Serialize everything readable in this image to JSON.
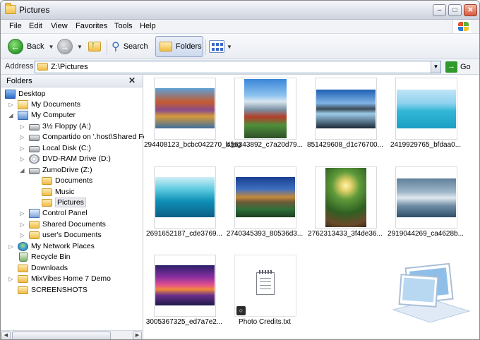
{
  "window": {
    "title": "Pictures",
    "controls": {
      "minimize": "–",
      "maximize": "□",
      "close": "✕"
    }
  },
  "menu": [
    "File",
    "Edit",
    "View",
    "Favorites",
    "Tools",
    "Help"
  ],
  "toolbar": {
    "back_label": "Back",
    "search_label": "Search",
    "folders_label": "Folders"
  },
  "address": {
    "label": "Address",
    "path": "Z:\\Pictures",
    "go_label": "Go"
  },
  "folders_pane": {
    "title": "Folders",
    "close": "✕",
    "tree": [
      {
        "label": "Desktop",
        "icon": "desktop-icon"
      },
      {
        "label": "My Documents",
        "icon": "my-documents-icon"
      },
      {
        "label": "My Computer",
        "icon": "my-computer-icon"
      },
      {
        "label": "3½ Floppy (A:)",
        "icon": "floppy-drive-icon"
      },
      {
        "label": "Compartido on '.host\\Shared Fol",
        "icon": "network-drive-icon"
      },
      {
        "label": "Local Disk (C:)",
        "icon": "local-disk-icon"
      },
      {
        "label": "DVD-RAM Drive (D:)",
        "icon": "dvd-drive-icon"
      },
      {
        "label": "ZumoDrive (Z:)",
        "icon": "zumodrive-icon"
      },
      {
        "label": "Documents",
        "icon": "folder-icon"
      },
      {
        "label": "Music",
        "icon": "folder-icon"
      },
      {
        "label": "Pictures",
        "icon": "folder-icon",
        "selected": true
      },
      {
        "label": "Control Panel",
        "icon": "control-panel-icon"
      },
      {
        "label": "Shared Documents",
        "icon": "folder-icon"
      },
      {
        "label": "user's Documents",
        "icon": "folder-icon"
      },
      {
        "label": "My Network Places",
        "icon": "network-places-icon"
      },
      {
        "label": "Recycle Bin",
        "icon": "recycle-bin-icon"
      },
      {
        "label": "Downloads",
        "icon": "folder-icon"
      },
      {
        "label": "MixVibes Home 7 Demo",
        "icon": "folder-icon"
      },
      {
        "label": "SCREENSHOTS",
        "icon": "folder-icon"
      }
    ]
  },
  "files": [
    {
      "caption": "294408123_bcbc042270_b.jpg",
      "icon": "image-thumbnail",
      "theme": "colorful-town"
    },
    {
      "caption": "456343892_c7a20d79...",
      "icon": "image-thumbnail",
      "theme": "city-skyline"
    },
    {
      "caption": "851429608_d1c76700...",
      "icon": "image-thumbnail",
      "theme": "mountain-lake"
    },
    {
      "caption": "2419929765_bfdaa0...",
      "icon": "image-thumbnail",
      "theme": "tropical-sea"
    },
    {
      "caption": "2691652187_cde3769...",
      "icon": "image-thumbnail",
      "theme": "turquoise-waves"
    },
    {
      "caption": "2740345393_80536d3...",
      "icon": "image-thumbnail",
      "theme": "cathedral-river"
    },
    {
      "caption": "2762313433_3f4de36...",
      "icon": "image-thumbnail",
      "theme": "forest-path"
    },
    {
      "caption": "2919044269_ca4628b...",
      "icon": "image-thumbnail",
      "theme": "misty-lake"
    },
    {
      "caption": "3005367325_ed7a7e2...",
      "icon": "image-thumbnail",
      "theme": "sunset-bridge"
    },
    {
      "caption": "Photo Credits.txt",
      "icon": "text-file-icon",
      "theme": "text"
    }
  ],
  "colors": {
    "selection": "#e8eaef",
    "go_green": "#2f9a2b",
    "xp_red": "#e9532e",
    "xp_green": "#5fb13a",
    "xp_blue": "#2d7ad8",
    "xp_yellow": "#f7c42d"
  }
}
